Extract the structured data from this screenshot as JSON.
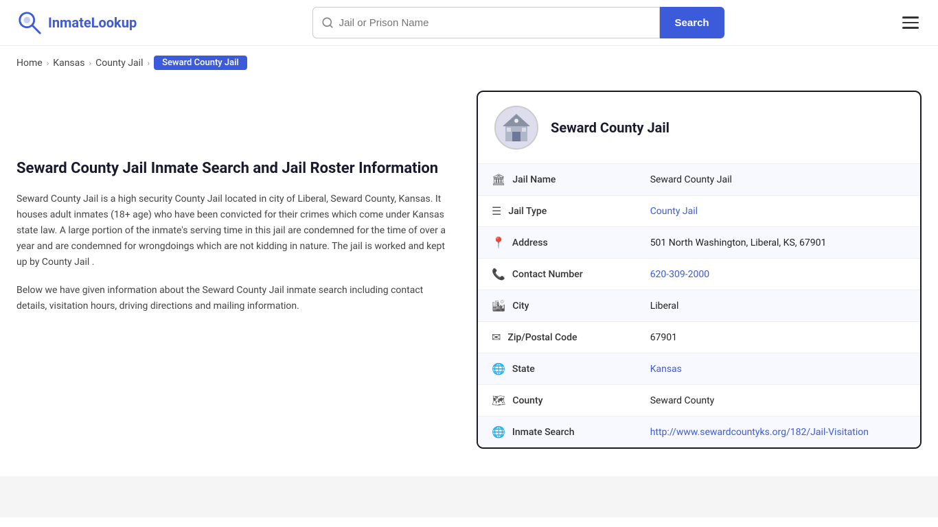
{
  "header": {
    "logo_text_prefix": "Inmate",
    "logo_text_suffix": "Lookup",
    "search_placeholder": "Jail or Prison Name",
    "search_button_label": "Search"
  },
  "breadcrumb": {
    "home": "Home",
    "state": "Kansas",
    "type": "County Jail",
    "current": "Seward County Jail"
  },
  "left": {
    "title": "Seward County Jail Inmate Search and Jail Roster Information",
    "desc1": "Seward County Jail is a high security County Jail located in city of Liberal, Seward County, Kansas. It houses adult inmates (18+ age) who have been convicted for their crimes which come under Kansas state law. A large portion of the inmate's serving time in this jail are condemned for the time of over a year and are condemned for wrongdoings which are not kidding in nature. The jail is worked and kept up by County Jail .",
    "desc2": "Below we have given information about the Seward County Jail inmate search including contact details, visitation hours, driving directions and mailing information."
  },
  "card": {
    "title": "Seward County Jail",
    "rows": [
      {
        "icon": "🏛",
        "label": "Jail Name",
        "value": "Seward County Jail",
        "link": null
      },
      {
        "icon": "☰",
        "label": "Jail Type",
        "value": "County Jail",
        "link": "#"
      },
      {
        "icon": "📍",
        "label": "Address",
        "value": "501 North Washington, Liberal, KS, 67901",
        "link": null
      },
      {
        "icon": "📞",
        "label": "Contact Number",
        "value": "620-309-2000",
        "link": "tel:620-309-2000"
      },
      {
        "icon": "🏙",
        "label": "City",
        "value": "Liberal",
        "link": null
      },
      {
        "icon": "✉",
        "label": "Zip/Postal Code",
        "value": "67901",
        "link": null
      },
      {
        "icon": "🌐",
        "label": "State",
        "value": "Kansas",
        "link": "#"
      },
      {
        "icon": "🗺",
        "label": "County",
        "value": "Seward County",
        "link": null
      },
      {
        "icon": "🌐",
        "label": "Inmate Search",
        "value": "http://www.sewardcountyks.org/182/Jail-Visitation",
        "link": "http://www.sewardcountyks.org/182/Jail-Visitation"
      }
    ]
  }
}
